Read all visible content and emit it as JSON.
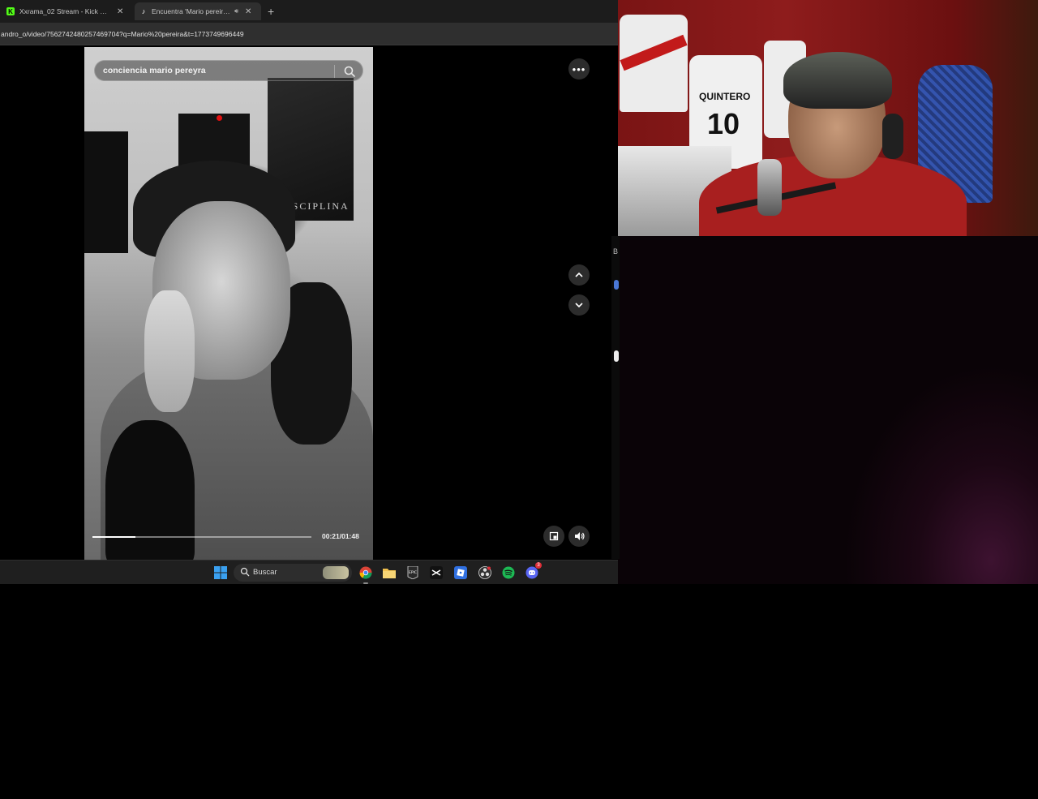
{
  "browser": {
    "tabs": [
      {
        "title": "Xxrama_02 Stream - Kick Dashb",
        "active": false,
        "favicon": "kick-icon",
        "close": "✕"
      },
      {
        "title": "Encuentra 'Mario pereira' en",
        "active": true,
        "favicon": "tiktok-icon",
        "audio": "speaker-icon",
        "close": "✕"
      }
    ],
    "new_tab": "+",
    "url": "andro_o/video/7562742480257469704?q=Mario%20pereira&t=1773749696449"
  },
  "player": {
    "search_value": "conciencia mario pereyra",
    "more": "•••",
    "time": "00:21/01:48",
    "progress": 0.195,
    "poster_text": "DISCIPLINA"
  },
  "webcam": {
    "jersey_name": "QUINTERO",
    "jersey_number": "10"
  },
  "side": {
    "letter": "B"
  },
  "taskbar": {
    "search_placeholder": "Buscar",
    "discord_badge": "3"
  },
  "colors": {
    "kick_green": "#53fc18",
    "spotify_green": "#1db954",
    "discord_blurple": "#5865f2",
    "jersey_red": "#a81f1f"
  }
}
